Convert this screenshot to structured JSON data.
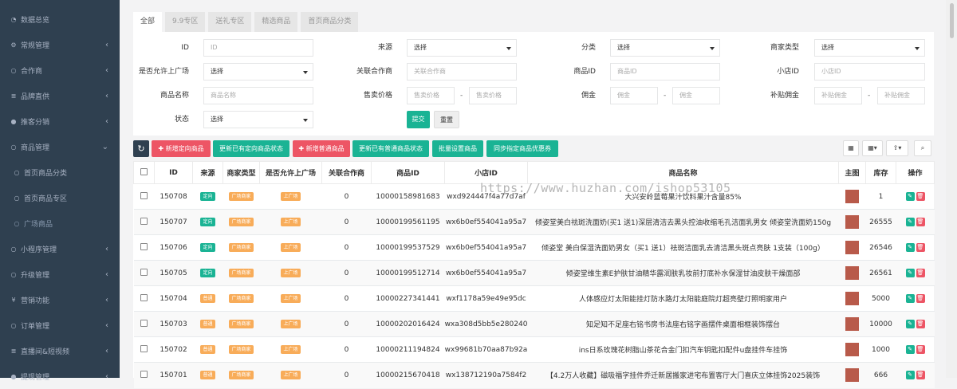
{
  "sidebar": {
    "items": [
      {
        "label": "数据总览",
        "icon": "dashboard-icon",
        "glyph": "◔",
        "arrow": ""
      },
      {
        "label": "常规管理",
        "icon": "cogs-icon",
        "glyph": "⚙",
        "arrow": "‹"
      },
      {
        "label": "合作商",
        "icon": "circle-icon",
        "glyph": "○",
        "arrow": "‹"
      },
      {
        "label": "品牌直供",
        "icon": "list-icon",
        "glyph": "≣",
        "arrow": "‹"
      },
      {
        "label": "推客分销",
        "icon": "user-circle-icon",
        "glyph": "●",
        "arrow": "‹"
      },
      {
        "label": "商品管理",
        "icon": "circle-icon",
        "glyph": "○",
        "arrow": "⌄"
      },
      {
        "label": "首页商品分类",
        "icon": "circle-icon",
        "glyph": "○",
        "arrow": "",
        "sub": true
      },
      {
        "label": "首页商品专区",
        "icon": "circle-icon",
        "glyph": "○",
        "arrow": "",
        "sub": true
      },
      {
        "label": "广场商品",
        "icon": "circle-icon",
        "glyph": "○",
        "arrow": "",
        "sub": true,
        "current": true
      },
      {
        "label": "小程序管理",
        "icon": "circle-icon",
        "glyph": "○",
        "arrow": "‹"
      },
      {
        "label": "升级管理",
        "icon": "circle-icon",
        "glyph": "○",
        "arrow": "‹"
      },
      {
        "label": "营销功能",
        "icon": "yen-icon",
        "glyph": "¥",
        "arrow": "‹"
      },
      {
        "label": "订单管理",
        "icon": "circle-icon",
        "glyph": "○",
        "arrow": "‹"
      },
      {
        "label": "直播间&短视频",
        "icon": "list-icon",
        "glyph": "≣",
        "arrow": "‹"
      },
      {
        "label": "提现管理",
        "icon": "user-circle-icon",
        "glyph": "●",
        "arrow": "‹"
      }
    ]
  },
  "tabs": [
    "全部",
    "9.9专区",
    "送礼专区",
    "精选商品",
    "首页商品分类"
  ],
  "filters": {
    "id_label": "ID",
    "id_placeholder": "ID",
    "source_label": "来源",
    "source_value": "选择",
    "category_label": "分类",
    "category_value": "选择",
    "merchant_type_label": "商家类型",
    "merchant_type_value": "选择",
    "allow_plaza_label": "是否允许上广场",
    "allow_plaza_value": "选择",
    "partner_label": "关联合作商",
    "partner_placeholder": "关联合作商",
    "goods_id_label": "商品ID",
    "goods_id_placeholder": "商品ID",
    "shop_id_label": "小店ID",
    "shop_id_placeholder": "小店ID",
    "goods_name_label": "商品名称",
    "goods_name_placeholder": "商品名称",
    "price_label": "售卖价格",
    "price_min_placeholder": "售卖价格",
    "price_max_placeholder": "售卖价格",
    "commission_label": "佣金",
    "commission_min_placeholder": "佣金",
    "commission_max_placeholder": "佣金",
    "subsidy_label": "补贴佣金",
    "subsidy_min_placeholder": "补贴佣金",
    "subsidy_max_placeholder": "补贴佣金",
    "status_label": "状态",
    "status_value": "选择",
    "dash": "-",
    "submit": "提交",
    "reset": "重置"
  },
  "toolbar": {
    "refresh": "↻",
    "add_targeted": "✚ 新增定向商品",
    "update_targeted": "更新已有定向商品状态",
    "add_normal": "✚ 新增普通商品",
    "update_normal": "更新已有普通商品状态",
    "batch_set": "批量设置商品",
    "sync_coupon": "同步指定商品优惠券",
    "view_icon": "▦",
    "columns_icon": "▦▾",
    "export_icon": "⇪▾",
    "search_icon": "⌕"
  },
  "table": {
    "headers": [
      "",
      "ID",
      "来源",
      "商家类型",
      "是否允许上广场",
      "关联合作商",
      "商品ID",
      "小店ID",
      "商品名称",
      "主图",
      "库存",
      "操作"
    ],
    "rows": [
      {
        "id": "150708",
        "source": "定向",
        "source_c": "g",
        "mtype": "广场商家",
        "plaza": "上广场",
        "partner": "0",
        "goods_id": "10000158981683",
        "shop_id": "wxd924447f4a77d7af",
        "name": "大兴安岭蓝莓果汁饮料果汁含量85%",
        "stock": "1"
      },
      {
        "id": "150707",
        "source": "定向",
        "source_c": "g",
        "mtype": "广场商家",
        "plaza": "上广场",
        "partner": "0",
        "goods_id": "10000199561195",
        "shop_id": "wx6b0ef554041a95a7",
        "name": "倾姿堂美白祛斑洗面奶(买1 送1)深层清洁去黑头控油收缩毛孔洁面乳男女 倾姿堂洗面奶150g",
        "stock": "26555"
      },
      {
        "id": "150706",
        "source": "定向",
        "source_c": "g",
        "mtype": "广场商家",
        "plaza": "上广场",
        "partner": "0",
        "goods_id": "10000199537529",
        "shop_id": "wx6b0ef554041a95a7",
        "name": "倾姿堂 美白保湿洗面奶男女（买1 送1）祛斑洁面乳去清洁黑头斑点亮肤 1支装（100g）",
        "stock": "26546"
      },
      {
        "id": "150705",
        "source": "定向",
        "source_c": "g",
        "mtype": "广场商家",
        "plaza": "上广场",
        "partner": "0",
        "goods_id": "10000199512714",
        "shop_id": "wx6b0ef554041a95a7",
        "name": "倾姿堂维生素E护肤甘油精华露润肤乳妆前打底补水保湿甘油皮肤干燥面部",
        "stock": "26561"
      },
      {
        "id": "150704",
        "source": "普通",
        "source_c": "o",
        "mtype": "广场商家",
        "plaza": "上广场",
        "partner": "0",
        "goods_id": "10000227341441",
        "shop_id": "wxf1178a59e49e95dc",
        "name": "人体感应灯太阳能挂灯防水路灯太阳能庭院灯超亮壁灯照明家用户",
        "stock": "5000"
      },
      {
        "id": "150703",
        "source": "普通",
        "source_c": "o",
        "mtype": "广场商家",
        "plaza": "上广场",
        "partner": "0",
        "goods_id": "10000202016424",
        "shop_id": "wxa308d5bb5e280240",
        "name": "知足知不足座右铭书房书法座右铭字画摆件桌面相框装饰摆台",
        "stock": "10000"
      },
      {
        "id": "150702",
        "source": "普通",
        "source_c": "o",
        "mtype": "广场商家",
        "plaza": "上广场",
        "partner": "0",
        "goods_id": "10000211194824",
        "shop_id": "wx99681b70aa87b92a",
        "name": "ins日系玫瑰花树脂山茶花合金门扣汽车钥匙扣配件u盘挂件车挂饰",
        "stock": "1000"
      },
      {
        "id": "150701",
        "source": "普通",
        "source_c": "o",
        "mtype": "广场商家",
        "plaza": "上广场",
        "partner": "0",
        "goods_id": "10000215670418",
        "shop_id": "wx138712190a7584f2",
        "name": "【4.2万人收藏】磁吸福字挂件乔迁新居搬家进宅布置客厅大门喜庆立体挂饰2025装饰",
        "stock": "666"
      }
    ]
  },
  "watermark": "https://www.huzhan.com/ishop53105",
  "colors": {
    "sidebar_bg": "#2f4050",
    "primary": "#1ab394",
    "danger": "#ed5565",
    "warning": "#f8ac59"
  }
}
